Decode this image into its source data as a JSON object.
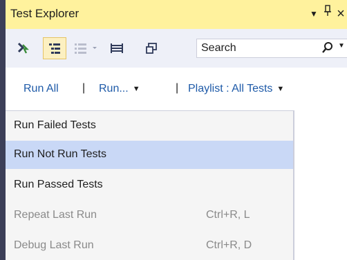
{
  "window": {
    "title": "Test Explorer",
    "controls": {
      "dropdown": "▼",
      "pin": "⊥",
      "close": "×"
    }
  },
  "toolbar": {
    "icons": [
      "run-tests-icon",
      "group-by-hierarchy-icon",
      "group-by-flat-icon",
      "playlist-icon",
      "copy-window-icon"
    ],
    "search_placeholder": "Search",
    "search_value": ""
  },
  "commands": {
    "run_all": "Run All",
    "separator": "|",
    "run": "Run...",
    "playlist": "Playlist : All Tests"
  },
  "menu": {
    "items": [
      {
        "label": "Run Failed Tests",
        "shortcut": "",
        "enabled": true,
        "highlighted": false
      },
      {
        "label": "Run Not Run Tests",
        "shortcut": "",
        "enabled": true,
        "highlighted": true
      },
      {
        "label": "Run Passed Tests",
        "shortcut": "",
        "enabled": true,
        "highlighted": false
      },
      {
        "label": "Repeat Last Run",
        "shortcut": "Ctrl+R, L",
        "enabled": false,
        "highlighted": false
      },
      {
        "label": "Debug Last Run",
        "shortcut": "Ctrl+R, D",
        "enabled": false,
        "highlighted": false
      }
    ]
  },
  "colors": {
    "title_bar": "#fff29d",
    "toolbar": "#eef0f8",
    "link": "#1e5aa8",
    "menu_bg": "#f5f5f5",
    "menu_highlight": "#c9d8f6",
    "disabled_text": "#8a8a8a"
  }
}
